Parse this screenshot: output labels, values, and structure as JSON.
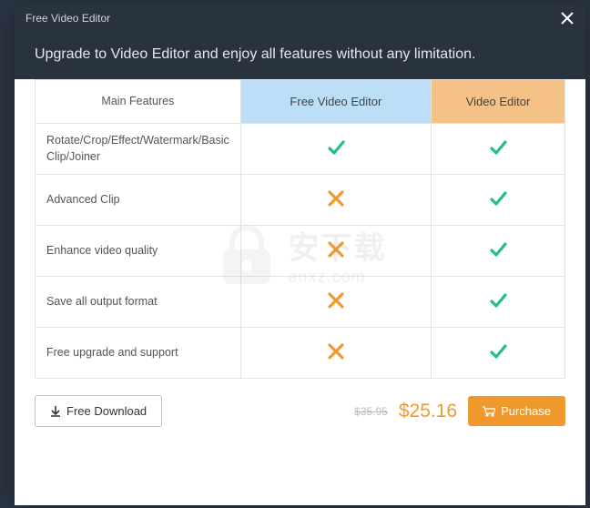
{
  "titlebar": {
    "title": "Free Video Editor"
  },
  "header": {
    "subtitle": "Upgrade to Video Editor and enjoy all features without any limitation."
  },
  "columns": {
    "c0": "Main Features",
    "c1": "Free Video Editor",
    "c2": "Video Editor"
  },
  "rows": {
    "r0": {
      "label": "Rotate/Crop/Effect/Watermark/Basic Clip/Joiner",
      "free": true,
      "paid": true
    },
    "r1": {
      "label": "Advanced Clip",
      "free": false,
      "paid": true
    },
    "r2": {
      "label": "Enhance video quality",
      "free": false,
      "paid": true
    },
    "r3": {
      "label": "Save all output format",
      "free": false,
      "paid": true
    },
    "r4": {
      "label": "Free upgrade and support",
      "free": false,
      "paid": true
    }
  },
  "footer": {
    "download": "Free Download",
    "old_price": "$35.95",
    "new_price": "$25.16",
    "purchase": "Purchase"
  },
  "watermark": {
    "cn": "安下载",
    "en": "anxz.com"
  }
}
